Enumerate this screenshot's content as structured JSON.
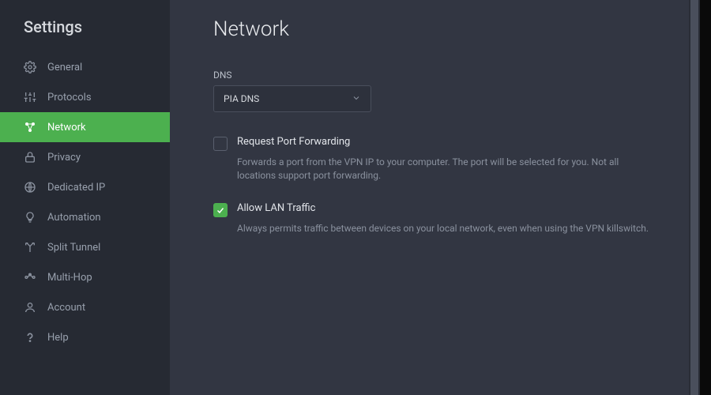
{
  "sidebar": {
    "title": "Settings",
    "items": [
      {
        "label": "General"
      },
      {
        "label": "Protocols"
      },
      {
        "label": "Network"
      },
      {
        "label": "Privacy"
      },
      {
        "label": "Dedicated IP"
      },
      {
        "label": "Automation"
      },
      {
        "label": "Split Tunnel"
      },
      {
        "label": "Multi-Hop"
      },
      {
        "label": "Account"
      },
      {
        "label": "Help"
      }
    ]
  },
  "page": {
    "title": "Network",
    "dns_label": "DNS",
    "dns_value": "PIA DNS",
    "options": [
      {
        "label": "Request Port Forwarding",
        "description": "Forwards a port from the VPN IP to your computer. The port will be selected for you. Not all locations support port forwarding.",
        "checked": false
      },
      {
        "label": "Allow LAN Traffic",
        "description": "Always permits traffic between devices on your local network, even when using the VPN killswitch.",
        "checked": true
      }
    ]
  }
}
